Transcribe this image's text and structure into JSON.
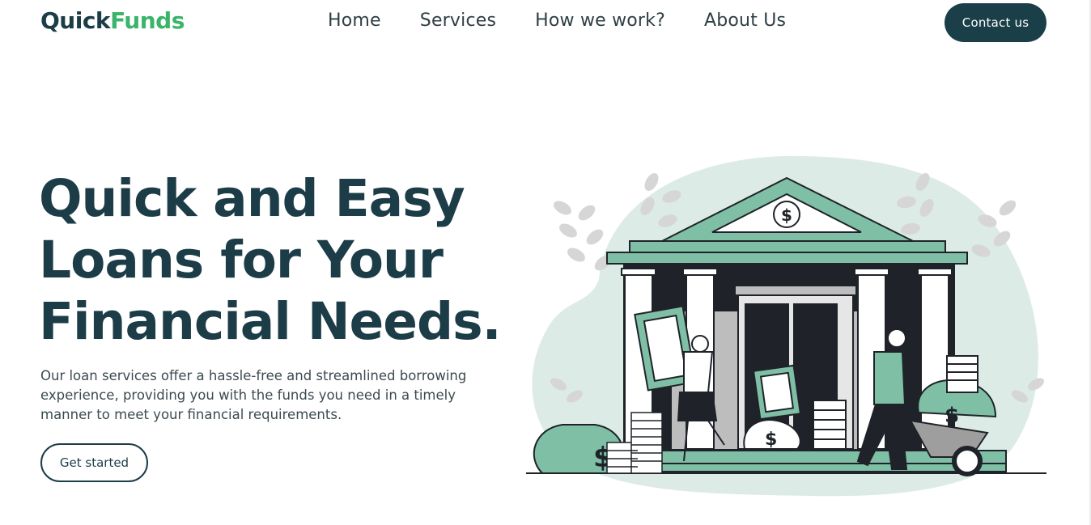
{
  "brand": {
    "part1": "Quick",
    "part2": "Funds"
  },
  "nav": {
    "links": [
      "Home",
      "Services",
      "How we work?",
      "About Us"
    ],
    "contact_label": "Contact us"
  },
  "hero": {
    "title_lines": [
      "Quick and Easy",
      "Loans for Your",
      "Financial Needs."
    ],
    "description": "Our loan services offer a hassle-free and streamlined borrowing experience, providing you with the funds you need in a timely manner to meet your financial requirements.",
    "cta_label": "Get started"
  },
  "illustration": {
    "coin_symbol": "$",
    "colors": {
      "accent": "#7fbfa5",
      "blob": "#dcebe6",
      "dark": "#1f2329",
      "leaf": "#d6d6d6"
    }
  },
  "colors": {
    "brand_dark": "#1c3d47",
    "brand_green": "#3bb46a",
    "button_dark": "#1b3f48"
  }
}
